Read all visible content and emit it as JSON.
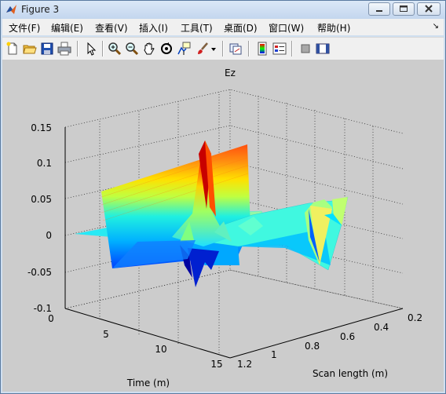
{
  "window": {
    "title": "Figure 3"
  },
  "menu": [
    {
      "label": "文件(F)"
    },
    {
      "label": "编辑(E)"
    },
    {
      "label": "查看(V)"
    },
    {
      "label": "插入(I)"
    },
    {
      "label": "工具(T)"
    },
    {
      "label": "桌面(D)"
    },
    {
      "label": "窗口(W)"
    },
    {
      "label": "帮助(H)"
    }
  ],
  "toolbar": {
    "icons": [
      "new-figure-icon",
      "open-file-icon",
      "save-icon",
      "print-icon",
      "pointer-icon",
      "zoom-in-icon",
      "zoom-out-icon",
      "pan-hand-icon",
      "rotate-3d-icon",
      "data-cursor-icon",
      "brush-icon",
      "brush-dropdown-icon",
      "link-plot-icon",
      "colorbar-icon",
      "legend-icon",
      "hide-plot-tools-icon",
      "show-plot-tools-icon"
    ]
  },
  "plot": {
    "title": "Ez",
    "z_ticks": [
      "0.15",
      "0.1",
      "0.05",
      "0",
      "-0.05",
      "-0.1"
    ],
    "time_ticks": [
      "0",
      "5",
      "10",
      "15"
    ],
    "scan_ticks": [
      "1.2",
      "1",
      "0.8",
      "0.6",
      "0.4",
      "0.2"
    ],
    "time_label": "Time (m)",
    "scan_label": "Scan length (m)",
    "colormap": [
      "#00008f",
      "#0000ff",
      "#0080ff",
      "#00ffff",
      "#80ff80",
      "#ffff00",
      "#ff8000",
      "#ff0000",
      "#800000"
    ]
  }
}
